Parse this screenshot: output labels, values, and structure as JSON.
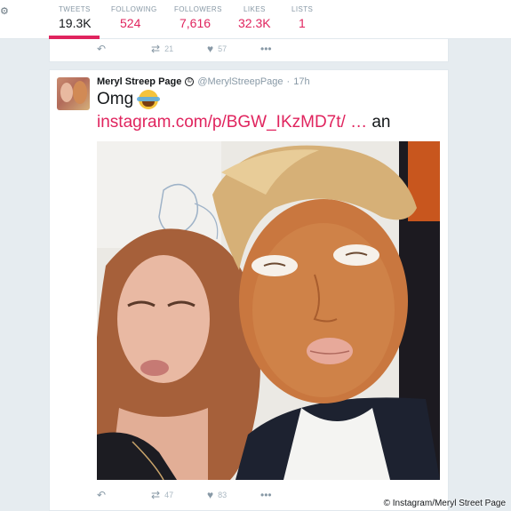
{
  "profile_nav": {
    "stats": [
      {
        "label": "TWEETS",
        "value": "19.3K",
        "active": true
      },
      {
        "label": "FOLLOWING",
        "value": "524"
      },
      {
        "label": "FOLLOWERS",
        "value": "7,616"
      },
      {
        "label": "LIKES",
        "value": "32.3K"
      },
      {
        "label": "LISTS",
        "value": "1"
      }
    ]
  },
  "prev_tweet": {
    "retweets": "21",
    "likes": "57"
  },
  "tweet": {
    "display_name": "Meryl Streep Page",
    "verified_mark": "©",
    "handle": "@MerylStreepPage",
    "separator": "·",
    "time": "17h",
    "text": "Omg",
    "emoji_icon": "face-with-tears-of-joy-emoji",
    "link": "instagram.com/p/BGW_IKzMD7t/",
    "ellipsis": "…",
    "trailing_text": "an",
    "retweets": "47",
    "likes": "83"
  },
  "watermark": "© Instagram/Meryl Street Page",
  "colors": {
    "accent": "#e0245e",
    "muted": "#8899a6",
    "background": "#e6ecf0"
  }
}
